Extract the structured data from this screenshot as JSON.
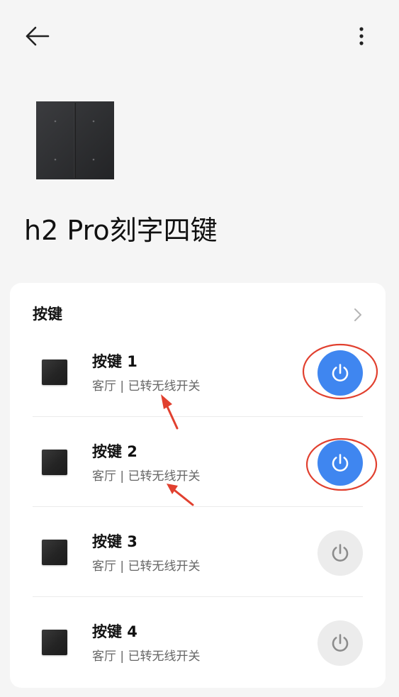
{
  "header": {
    "back_icon": "arrow-left-icon",
    "more_icon": "more-vertical-icon"
  },
  "device": {
    "title": "h2 Pro刻字四键",
    "image_icon": "four-key-switch-panel"
  },
  "section": {
    "title": "按键",
    "chevron_icon": "chevron-right-icon"
  },
  "buttons": [
    {
      "name": "按键 1",
      "subtitle": "客厅 | 已转无线开关",
      "state": "on"
    },
    {
      "name": "按键 2",
      "subtitle": "客厅 | 已转无线开关",
      "state": "on"
    },
    {
      "name": "按键 3",
      "subtitle": "客厅 | 已转无线开关",
      "state": "off"
    },
    {
      "name": "按键 4",
      "subtitle": "客厅 | 已转无线开关",
      "state": "off"
    }
  ],
  "annotations": {
    "color": "#e1402f",
    "marks": [
      "circle around power button 1",
      "circle around power button 2",
      "arrow pointing to 已转无线开关 of 按键 1",
      "arrow pointing to 已转无线开关 of 按键 2"
    ]
  },
  "colors": {
    "background": "#f5f5f5",
    "card": "#ffffff",
    "power_on": "#3f86f0",
    "power_off": "#ececec",
    "power_off_icon": "#8c8c8c"
  }
}
